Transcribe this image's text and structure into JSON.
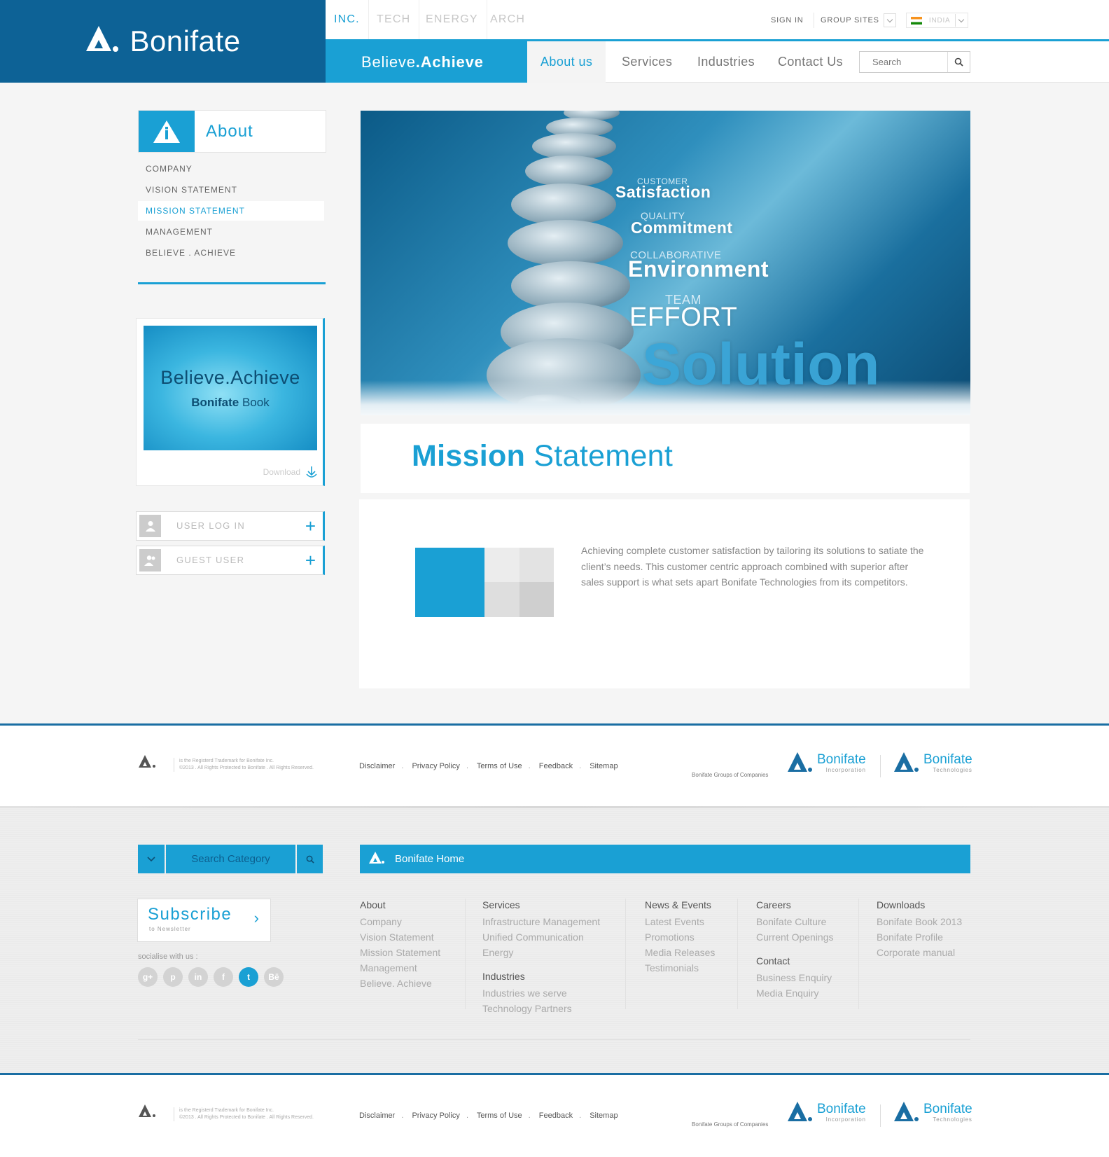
{
  "header": {
    "brand": "Bonifate",
    "company_tabs": [
      "INC.",
      "TECH",
      "ENERGY",
      "ARCH"
    ],
    "sign_in": "SIGN IN",
    "group_sites": "GROUP SITES",
    "country": "INDIA",
    "tagline_a": "Believe",
    "tagline_b": ".",
    "tagline_c": "Achieve",
    "nav": [
      "About us",
      "Services",
      "Industries",
      "Contact Us"
    ],
    "search_placeholder": "Search"
  },
  "sidebar": {
    "title": "About",
    "links": [
      "COMPANY",
      "VISION STATEMENT",
      "MISSION STATEMENT",
      "MANAGEMENT",
      "BELIEVE . ACHIEVE"
    ],
    "book_title": "Believe.Achieve",
    "book_brand": "Bonifate",
    "book_word": " Book",
    "download": "Download",
    "user_login": "USER LOG IN",
    "guest_user": "GUEST USER"
  },
  "hero": {
    "pairs": [
      {
        "small": "CUSTOMER",
        "big": "Satisfaction"
      },
      {
        "small": "QUALITY",
        "big": "Commitment"
      },
      {
        "small": "COLLABORATIVE",
        "big": "Environment"
      },
      {
        "small": "TEAM",
        "big": "EFFORT"
      }
    ],
    "solution": "Solution"
  },
  "mission": {
    "title_bold": "Mission",
    "title_rest": " Statement",
    "text": "Achieving complete customer satisfaction by tailoring its solutions to satiate the client’s needs.  This customer centric approach combined with superior after sales support is what sets apart Bonifate Technologies from its competitors."
  },
  "footer": {
    "legal_1": "is the Registerd Trademark for Bonifate Inc.",
    "legal_2": "©2013 . All Rights Protected to Bonifate . All Rights Reserved.",
    "links": [
      "Disclaimer",
      "Privacy Policy",
      "Terms of Use",
      "Feedback",
      "Sitemap"
    ],
    "groups": "Bonifate Groups of Companies",
    "logo1_name": "Bonifate",
    "logo1_sub": "Incorporation",
    "logo2_name": "Bonifate",
    "logo2_sub": "Technologies"
  },
  "footer2": {
    "search_category": "Search Category",
    "home": "Bonifate Home",
    "subscribe": "Subscribe",
    "subscribe_sub": "to Newsletter",
    "socialise": "socialise with us :",
    "social": [
      "g+",
      "p",
      "in",
      "f",
      "t",
      "Bē"
    ],
    "columns": {
      "about": {
        "h": "About",
        "items": [
          "Company",
          "Vision Statement",
          "Mission Statement",
          "Management",
          "Believe. Achieve"
        ]
      },
      "services": {
        "h": "Services",
        "items": [
          "Infrastructure Management",
          "Unified Communication",
          "Energy"
        ]
      },
      "industries": {
        "h": "Industries",
        "items": [
          "Industries we serve",
          "Technology Partners"
        ]
      },
      "news": {
        "h": "News & Events",
        "items": [
          "Latest Events",
          "Promotions",
          "Media Releases",
          "Testimonials"
        ]
      },
      "careers": {
        "h": "Careers",
        "items": [
          "Bonifate Culture",
          "Current Openings"
        ]
      },
      "contact": {
        "h": "Contact",
        "items": [
          "Business Enquiry",
          "Media Enquiry"
        ]
      },
      "downloads": {
        "h": "Downloads",
        "items": [
          "Bonifate Book 2013",
          "Bonifate Profile",
          "Corporate manual"
        ]
      }
    }
  },
  "colors": {
    "brand_dark": "#0d6296",
    "accent": "#1aa0d4"
  }
}
